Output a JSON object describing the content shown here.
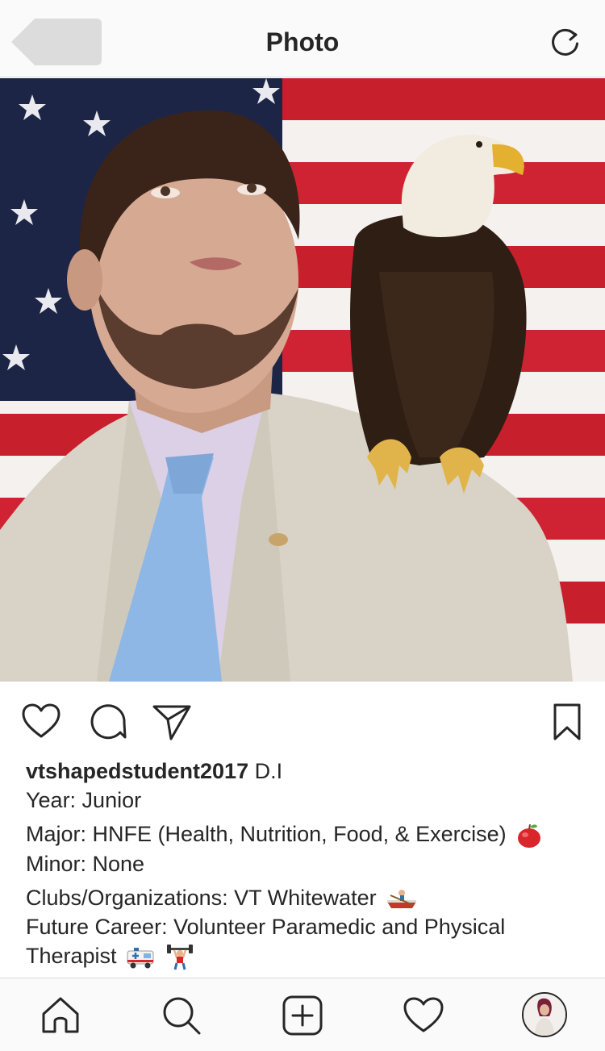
{
  "header": {
    "title": "Photo"
  },
  "post": {
    "username": "vtshapedstudent2017",
    "user_suffix": "D.I",
    "caption_lines": {
      "year": "Year: Junior",
      "major": "Major: HNFE (Health, Nutrition, Food, & Exercise)",
      "minor": "Minor: None",
      "clubs": "Clubs/Organizations: VT Whitewater",
      "career_1": "Future Career: Volunteer Paramedic and Physical",
      "career_2": "Therapist"
    },
    "emojis": {
      "major": "red-apple-emoji",
      "clubs": "rowboat-emoji",
      "career_a": "ambulance-emoji",
      "career_b": "weightlifter-emoji"
    }
  },
  "icons": {
    "like": "heart-icon",
    "comment": "comment-icon",
    "share": "send-icon",
    "save": "bookmark-icon",
    "home": "home-icon",
    "search": "search-icon",
    "add": "plus-square-icon",
    "activity": "heart-icon",
    "refresh": "refresh-icon"
  },
  "colors": {
    "text": "#262626",
    "bar_background": "#fafafa",
    "divider": "#dbdbdb",
    "apple_red": "#d9262b"
  }
}
